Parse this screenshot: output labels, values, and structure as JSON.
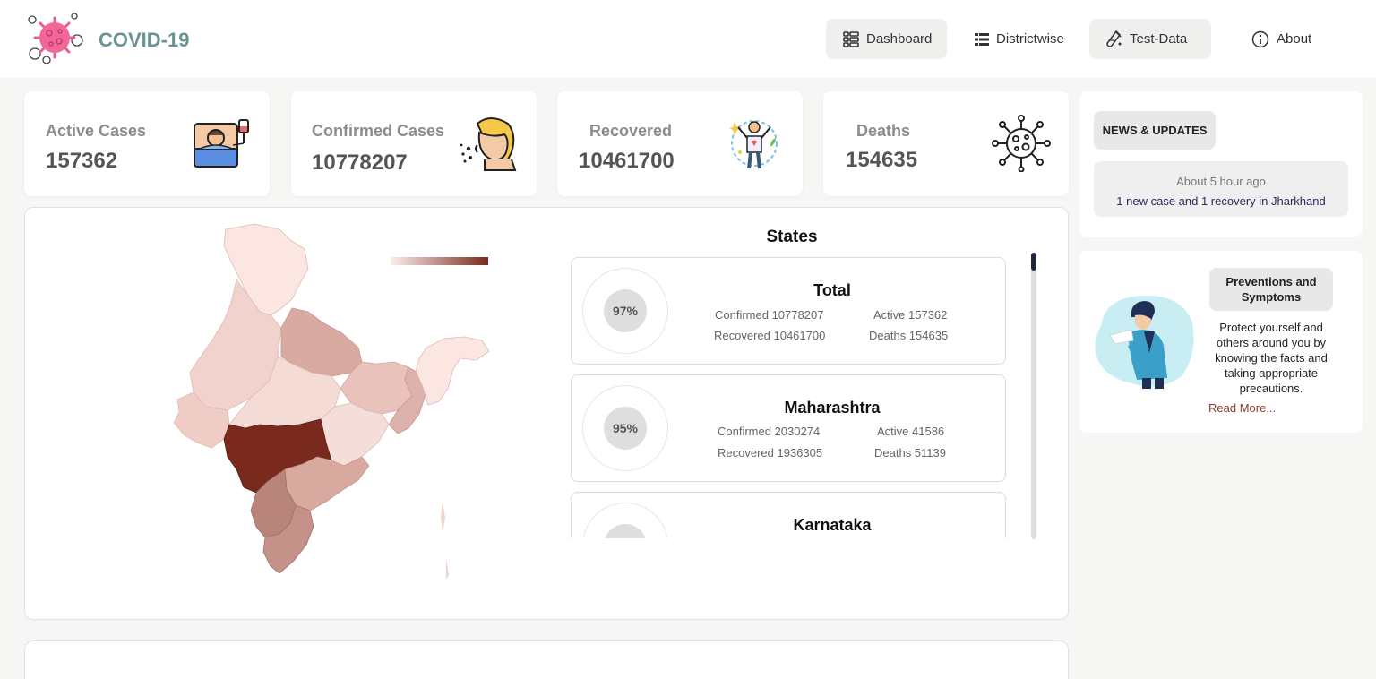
{
  "brand": {
    "title": "COVID-19",
    "logo_icon": "virus-logo-icon"
  },
  "nav": [
    {
      "label": "Dashboard",
      "icon": "dashboard-icon",
      "active": true
    },
    {
      "label": "Districtwise",
      "icon": "list-icon",
      "active": false
    },
    {
      "label": "Test-Data",
      "icon": "test-tube-icon",
      "active": true
    },
    {
      "label": "About",
      "icon": "info-icon",
      "active": false
    }
  ],
  "stats": [
    {
      "label": "Active Cases",
      "value": "157362",
      "icon": "patient-bed-icon"
    },
    {
      "label": "Confirmed Cases",
      "value": "10778207",
      "icon": "coughing-person-icon"
    },
    {
      "label": "Recovered",
      "value": "10461700",
      "icon": "recovered-person-icon"
    },
    {
      "label": "Deaths",
      "value": "154635",
      "icon": "virus-icon"
    }
  ],
  "map": {
    "legend_colors": [
      "#fbeeeb",
      "#7a2a1c"
    ],
    "highlight_color": "#7a2a1c"
  },
  "states": {
    "title": "States",
    "items": [
      {
        "name": "Total",
        "percent": "97%",
        "confirmed": "Confirmed 10778207",
        "active": "Active 157362",
        "recovered": "Recovered 10461700",
        "deaths": "Deaths 154635"
      },
      {
        "name": "Maharashtra",
        "percent": "95%",
        "confirmed": "Confirmed 2030274",
        "active": "Active 41586",
        "recovered": "Recovered 1936305",
        "deaths": "Deaths 51139"
      },
      {
        "name": "Karnataka"
      }
    ]
  },
  "news": {
    "badge": "NEWS & UPDATES",
    "items": [
      {
        "time": "About 5 hour ago",
        "text": "1 new case and 1 recovery in Jharkhand"
      }
    ]
  },
  "prevention": {
    "badge": "Preventions and Symptoms",
    "text": "Protect yourself and others around you by knowing the facts and taking appropriate precautions.",
    "link": "Read More..."
  }
}
